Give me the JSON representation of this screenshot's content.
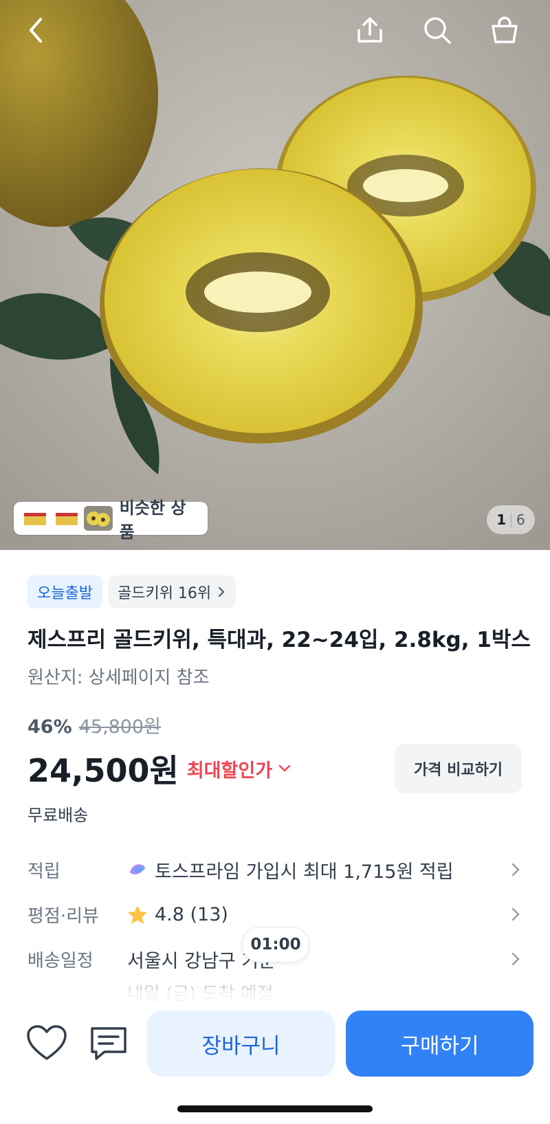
{
  "gallery": {
    "similar_label": "비슷한 상품",
    "counter_current": "1",
    "counter_total": "6"
  },
  "tags": {
    "today_ship": "오늘출발",
    "rank": "골드키위 16위"
  },
  "product": {
    "title": "제스프리 골드키위, 특대과, 22~24입, 2.8kg, 1박스",
    "origin": "원산지: 상세페이지 참조",
    "discount_pct": "46%",
    "original_price": "45,800원",
    "price": "24,500원",
    "max_discount": "최대할인가",
    "compare_btn": "가격 비교하기",
    "shipping": "무료배송"
  },
  "info": {
    "points_label": "적립",
    "points_value": "토스프라임 가입시 최대 1,715원 적립",
    "rating_label": "평점·리뷰",
    "rating_value": "4.8 (13)",
    "delivery_label": "배송일정",
    "delivery_value": "서울시 강남구 기준",
    "delivery_sub": "내일 (금) 도착 예정",
    "time_bubble": "01:00"
  },
  "actions": {
    "cart": "장바구니",
    "buy": "구매하기"
  },
  "colors": {
    "accent": "#3182f6",
    "accent_light": "#e8f3ff",
    "discount_red": "#f04452"
  }
}
